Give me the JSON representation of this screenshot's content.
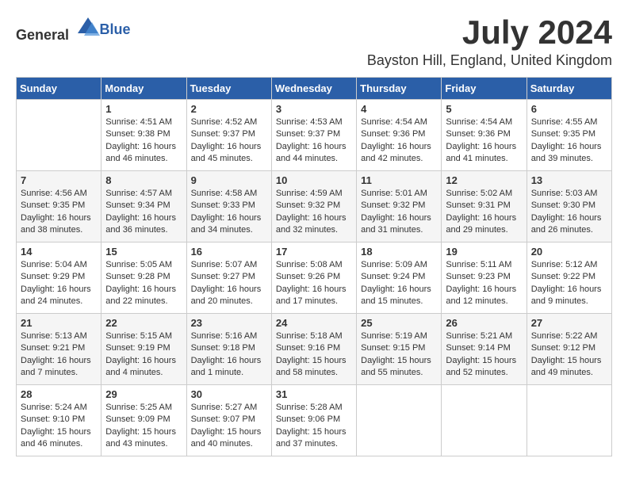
{
  "header": {
    "logo_general": "General",
    "logo_blue": "Blue",
    "month_year": "July 2024",
    "location": "Bayston Hill, England, United Kingdom"
  },
  "calendar": {
    "days_of_week": [
      "Sunday",
      "Monday",
      "Tuesday",
      "Wednesday",
      "Thursday",
      "Friday",
      "Saturday"
    ],
    "weeks": [
      [
        {
          "day": "",
          "info": ""
        },
        {
          "day": "1",
          "info": "Sunrise: 4:51 AM\nSunset: 9:38 PM\nDaylight: 16 hours\nand 46 minutes."
        },
        {
          "day": "2",
          "info": "Sunrise: 4:52 AM\nSunset: 9:37 PM\nDaylight: 16 hours\nand 45 minutes."
        },
        {
          "day": "3",
          "info": "Sunrise: 4:53 AM\nSunset: 9:37 PM\nDaylight: 16 hours\nand 44 minutes."
        },
        {
          "day": "4",
          "info": "Sunrise: 4:54 AM\nSunset: 9:36 PM\nDaylight: 16 hours\nand 42 minutes."
        },
        {
          "day": "5",
          "info": "Sunrise: 4:54 AM\nSunset: 9:36 PM\nDaylight: 16 hours\nand 41 minutes."
        },
        {
          "day": "6",
          "info": "Sunrise: 4:55 AM\nSunset: 9:35 PM\nDaylight: 16 hours\nand 39 minutes."
        }
      ],
      [
        {
          "day": "7",
          "info": "Sunrise: 4:56 AM\nSunset: 9:35 PM\nDaylight: 16 hours\nand 38 minutes."
        },
        {
          "day": "8",
          "info": "Sunrise: 4:57 AM\nSunset: 9:34 PM\nDaylight: 16 hours\nand 36 minutes."
        },
        {
          "day": "9",
          "info": "Sunrise: 4:58 AM\nSunset: 9:33 PM\nDaylight: 16 hours\nand 34 minutes."
        },
        {
          "day": "10",
          "info": "Sunrise: 4:59 AM\nSunset: 9:32 PM\nDaylight: 16 hours\nand 32 minutes."
        },
        {
          "day": "11",
          "info": "Sunrise: 5:01 AM\nSunset: 9:32 PM\nDaylight: 16 hours\nand 31 minutes."
        },
        {
          "day": "12",
          "info": "Sunrise: 5:02 AM\nSunset: 9:31 PM\nDaylight: 16 hours\nand 29 minutes."
        },
        {
          "day": "13",
          "info": "Sunrise: 5:03 AM\nSunset: 9:30 PM\nDaylight: 16 hours\nand 26 minutes."
        }
      ],
      [
        {
          "day": "14",
          "info": "Sunrise: 5:04 AM\nSunset: 9:29 PM\nDaylight: 16 hours\nand 24 minutes."
        },
        {
          "day": "15",
          "info": "Sunrise: 5:05 AM\nSunset: 9:28 PM\nDaylight: 16 hours\nand 22 minutes."
        },
        {
          "day": "16",
          "info": "Sunrise: 5:07 AM\nSunset: 9:27 PM\nDaylight: 16 hours\nand 20 minutes."
        },
        {
          "day": "17",
          "info": "Sunrise: 5:08 AM\nSunset: 9:26 PM\nDaylight: 16 hours\nand 17 minutes."
        },
        {
          "day": "18",
          "info": "Sunrise: 5:09 AM\nSunset: 9:24 PM\nDaylight: 16 hours\nand 15 minutes."
        },
        {
          "day": "19",
          "info": "Sunrise: 5:11 AM\nSunset: 9:23 PM\nDaylight: 16 hours\nand 12 minutes."
        },
        {
          "day": "20",
          "info": "Sunrise: 5:12 AM\nSunset: 9:22 PM\nDaylight: 16 hours\nand 9 minutes."
        }
      ],
      [
        {
          "day": "21",
          "info": "Sunrise: 5:13 AM\nSunset: 9:21 PM\nDaylight: 16 hours\nand 7 minutes."
        },
        {
          "day": "22",
          "info": "Sunrise: 5:15 AM\nSunset: 9:19 PM\nDaylight: 16 hours\nand 4 minutes."
        },
        {
          "day": "23",
          "info": "Sunrise: 5:16 AM\nSunset: 9:18 PM\nDaylight: 16 hours\nand 1 minute."
        },
        {
          "day": "24",
          "info": "Sunrise: 5:18 AM\nSunset: 9:16 PM\nDaylight: 15 hours\nand 58 minutes."
        },
        {
          "day": "25",
          "info": "Sunrise: 5:19 AM\nSunset: 9:15 PM\nDaylight: 15 hours\nand 55 minutes."
        },
        {
          "day": "26",
          "info": "Sunrise: 5:21 AM\nSunset: 9:14 PM\nDaylight: 15 hours\nand 52 minutes."
        },
        {
          "day": "27",
          "info": "Sunrise: 5:22 AM\nSunset: 9:12 PM\nDaylight: 15 hours\nand 49 minutes."
        }
      ],
      [
        {
          "day": "28",
          "info": "Sunrise: 5:24 AM\nSunset: 9:10 PM\nDaylight: 15 hours\nand 46 minutes."
        },
        {
          "day": "29",
          "info": "Sunrise: 5:25 AM\nSunset: 9:09 PM\nDaylight: 15 hours\nand 43 minutes."
        },
        {
          "day": "30",
          "info": "Sunrise: 5:27 AM\nSunset: 9:07 PM\nDaylight: 15 hours\nand 40 minutes."
        },
        {
          "day": "31",
          "info": "Sunrise: 5:28 AM\nSunset: 9:06 PM\nDaylight: 15 hours\nand 37 minutes."
        },
        {
          "day": "",
          "info": ""
        },
        {
          "day": "",
          "info": ""
        },
        {
          "day": "",
          "info": ""
        }
      ]
    ]
  }
}
